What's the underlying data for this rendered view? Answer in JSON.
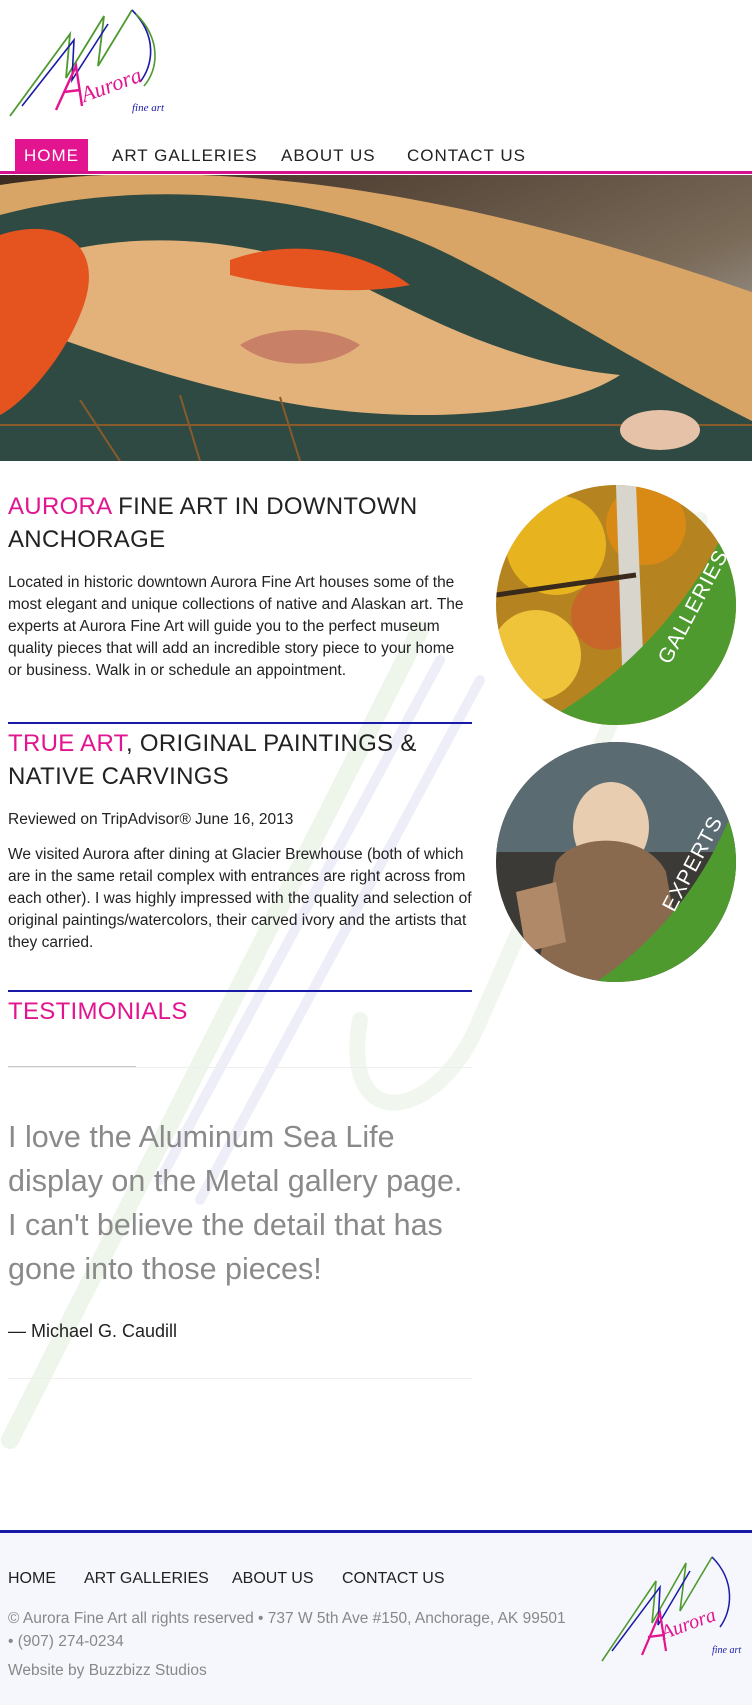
{
  "logo": {
    "name": "Aurora",
    "tagline": "fine art"
  },
  "nav": {
    "items": [
      "Home",
      "Art Galleries",
      "About Us",
      "Contact Us"
    ],
    "active": "Home"
  },
  "section1": {
    "title_accent": "AURORA",
    "title_rest": " FINE ART IN DOWNTOWN ANCHORAGE",
    "body": "Located in historic downtown Aurora Fine Art houses some of the most elegant and unique collections of native and Alaskan art. The experts at Aurora Fine Art will guide you to the perfect museum quality pieces that will add an incredible story piece to your home or business. Walk in or schedule an appointment."
  },
  "section2": {
    "title_accent": "TRUE ART",
    "title_rest": ", ORIGINAL PAINTINGS & NATIVE CARVINGS",
    "review_date": "Reviewed on TripAdvisor® June 16, 2013",
    "review_body": "We visited Aurora after dining at Glacier Brewhouse (both of which are in the same retail complex with entrances are right across from each other). I was highly impressed with the quality and selection of original paintings/watercolors, their carved ivory and the artists that they carried."
  },
  "testimonials": {
    "title": "TESTIMONIALS",
    "quote": "I love the Aluminum Sea Life display on the Metal gallery page. I can't believe the detail that has gone into those pieces!",
    "author": "— Michael G. Caudill"
  },
  "side_links": [
    {
      "label": "GALLERIES"
    },
    {
      "label": "EXPERTS"
    }
  ],
  "footer": {
    "nav": [
      "Home",
      "Art Galleries",
      "About Us",
      "Contact Us"
    ],
    "copyright": "© Aurora Fine Art all rights reserved • 737 W 5th Ave #150, Anchorage, AK 99501 • (907) 274-0234",
    "credit": "Website by Buzzbizz Studios"
  },
  "colors": {
    "accent_pink": "#e3148f",
    "accent_blue": "#1a1aa8",
    "accent_green": "#4e9a2f"
  }
}
